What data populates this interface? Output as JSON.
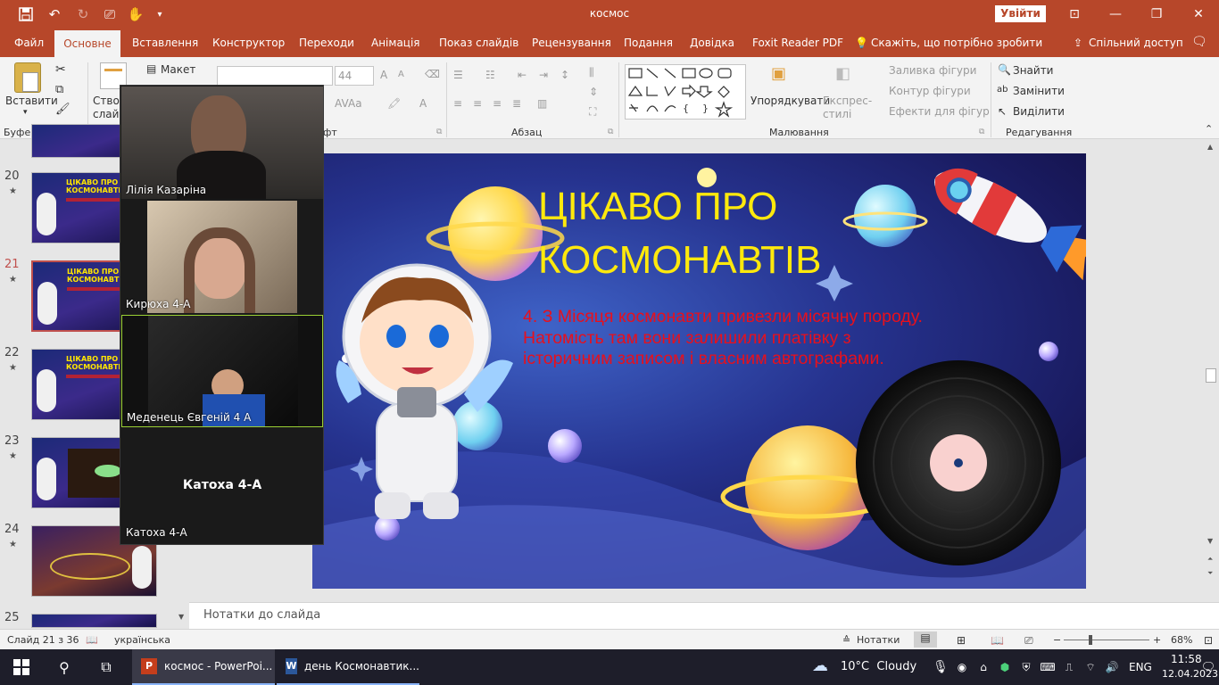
{
  "titlebar": {
    "doc_title": "космос",
    "signin": "Увійти",
    "icons": [
      "save-icon",
      "undo-icon",
      "redo-icon",
      "present-icon",
      "touch-mode-icon",
      "customize-qat-icon"
    ]
  },
  "menu": {
    "active": "Основне",
    "items": [
      "Файл",
      "Вставлення",
      "Конструктор",
      "Переходи",
      "Анімація",
      "Показ слайдів",
      "Рецензування",
      "Подання",
      "Довідка",
      "Foxit Reader PDF"
    ],
    "tell_me": "Скажіть, що потрібно зробити",
    "share": "Спільний доступ"
  },
  "ribbon": {
    "paste": "Вставити",
    "new_slide": "Створити слайд",
    "layout": "Макет",
    "font_size": "44",
    "shape_fill": "Заливка фігури",
    "shape_outline": "Контур фігури",
    "shape_effects": "Ефекти для фігур",
    "arrange": "Упорядкувати",
    "quick_styles": "Експрес-стилі",
    "find": "Знайти",
    "replace": "Замінити",
    "select": "Виділити",
    "groups": {
      "clipboard": "Буфер обміну",
      "font": "фт",
      "paragraph": "Абзац",
      "drawing": "Малювання",
      "editing": "Редагування"
    }
  },
  "thumbnails": [
    {
      "num": "20",
      "title": "ЦІКАВО ПРО КОСМОНАВТІВ"
    },
    {
      "num": "21",
      "title": "ЦІКАВО ПРО КОСМОНАВТІВ"
    },
    {
      "num": "22",
      "title": "ЦІКАВО ПРО КОСМОНАВТІВ"
    },
    {
      "num": "23",
      "title": ""
    },
    {
      "num": "24",
      "title": ""
    },
    {
      "num": "25",
      "title": ""
    }
  ],
  "slide": {
    "title_line1": "ЦІКАВО ПРО",
    "title_line2": "КОСМОНАВТІВ",
    "body": "4. З Місяця космонавти привезли місячну породу. Натомість там вони залишили платівку з історичним записом і власним автографами."
  },
  "notes_placeholder": "Нотатки до слайда",
  "status": {
    "slide_counter": "Слайд 21 з 36",
    "language": "українська",
    "notes_button": "Нотатки",
    "zoom": "68%"
  },
  "zoom_call": {
    "participants": [
      {
        "name": "Лілія Казаріна"
      },
      {
        "name": "Кирюха 4-А"
      },
      {
        "name": "Меденець Євгеній 4 А"
      },
      {
        "name": "Катоха 4-А",
        "center_label": "Катоха 4-А"
      }
    ]
  },
  "taskbar": {
    "apps": [
      {
        "label": "космос - PowerPoi..."
      },
      {
        "label": "день Космонавтик..."
      }
    ],
    "weather": "10°C  Cloudy",
    "lang": "ENG",
    "time": "11:58",
    "date": "12.04.2023"
  },
  "colors": {
    "accent": "#b7472a",
    "slide_title": "#ffe90c",
    "slide_body": "#e8101c"
  }
}
